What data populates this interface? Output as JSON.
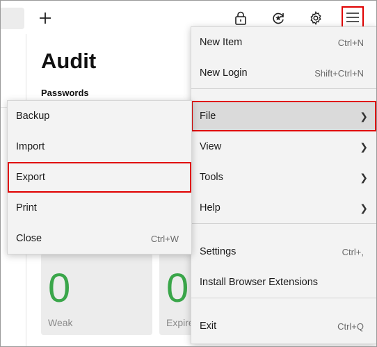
{
  "main": {
    "title": "Audit",
    "section": "Passwords",
    "cards": [
      {
        "value": "0",
        "label": "Weak",
        "value_color": "#3aa64a"
      },
      {
        "value": "0",
        "label": "Expire",
        "value_color": "#3aa64a"
      }
    ]
  },
  "toolbar": {
    "icons": [
      "plus-icon",
      "lock-icon",
      "sync-icon",
      "gear-icon",
      "hamburger-menu-icon"
    ]
  },
  "main_menu": {
    "items": [
      {
        "label": "New Item",
        "shortcut": "Ctrl+N"
      },
      {
        "label": "New Login",
        "shortcut": "Shift+Ctrl+N"
      },
      {
        "label": "File",
        "submenu": true,
        "highlighted": true
      },
      {
        "label": "View",
        "submenu": true
      },
      {
        "label": "Tools",
        "submenu": true
      },
      {
        "label": "Help",
        "submenu": true
      },
      {
        "label": "Settings",
        "shortcut": "Ctrl+,"
      },
      {
        "label": "Install Browser Extensions",
        "shortcut": ""
      },
      {
        "label": "Exit",
        "shortcut": "Ctrl+Q"
      }
    ]
  },
  "file_submenu": {
    "items": [
      {
        "label": "Backup",
        "shortcut": ""
      },
      {
        "label": "Import",
        "shortcut": ""
      },
      {
        "label": "Export",
        "shortcut": "",
        "highlighted": true
      },
      {
        "label": "Print",
        "shortcut": ""
      },
      {
        "label": "Close",
        "shortcut": "Ctrl+W"
      }
    ]
  },
  "colors": {
    "highlight_outline": "#e00000",
    "menu_bg": "#f3f3f3",
    "hover_bg": "#dadada",
    "good_value": "#3aa64a"
  }
}
